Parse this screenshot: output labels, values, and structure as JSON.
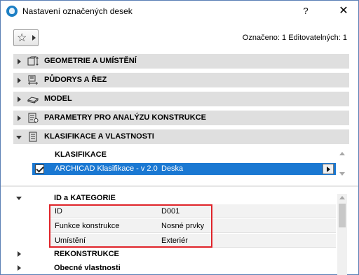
{
  "window": {
    "title": "Nastavení označených desek",
    "help_label": "?",
    "close_label": "✕"
  },
  "toolbar": {
    "favorites_icon": "star-icon",
    "status": "Označeno: 1 Editovatelných: 1"
  },
  "sections": [
    {
      "label": "GEOMETRIE A UMÍSTĚNÍ",
      "icon": "geometry-icon",
      "expanded": false
    },
    {
      "label": "PŮDORYS A ŘEZ",
      "icon": "floorplan-icon",
      "expanded": false
    },
    {
      "label": "MODEL",
      "icon": "model-icon",
      "expanded": false
    },
    {
      "label": "PARAMETRY PRO ANALÝZU KONSTRUKCE",
      "icon": "structural-analysis-icon",
      "expanded": false
    },
    {
      "label": "KLASIFIKACE A VLASTNOSTI",
      "icon": "document-icon",
      "expanded": true
    }
  ],
  "classification": {
    "header": "KLASIFIKACE",
    "row": {
      "checked": true,
      "system": "ARCHICAD Klasifikace - v 2.0",
      "value": "Deska"
    }
  },
  "properties": {
    "group_title": "ID a KATEGORIE",
    "rows": [
      {
        "name": "ID",
        "value": "D001"
      },
      {
        "name": "Funkce konstrukce",
        "value": "Nosné prvky"
      },
      {
        "name": "Umístění",
        "value": "Exteriér"
      }
    ],
    "subgroups": [
      "REKONSTRUKCE",
      "Obecné vlastnosti"
    ]
  },
  "colors": {
    "selection": "#1a78d2",
    "highlight": "#e0242a",
    "section_bg": "#dfdfdf"
  }
}
